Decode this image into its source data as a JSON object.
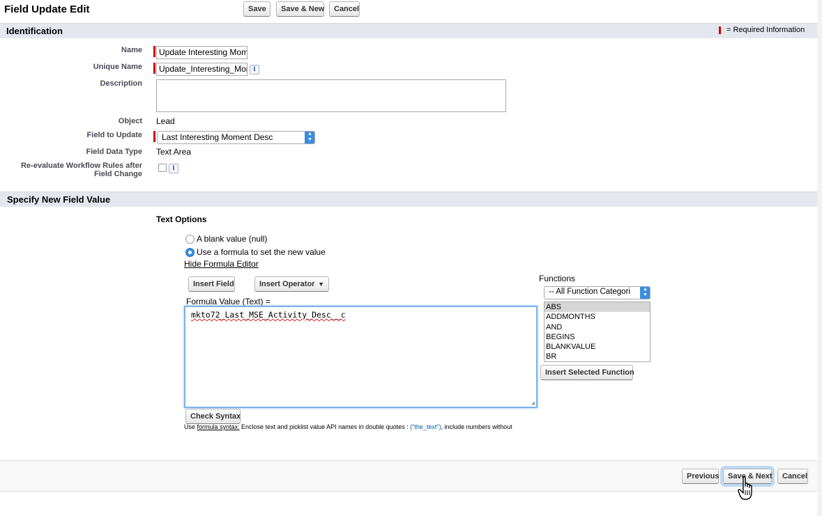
{
  "header": {
    "title": "Field Update Edit",
    "save_label": "Save",
    "save_new_label": "Save & New",
    "cancel_label": "Cancel"
  },
  "identification": {
    "section_title": "Identification",
    "required_legend": "= Required Information",
    "name_label": "Name",
    "name_value": "Update Interesting Mom",
    "unique_name_label": "Unique Name",
    "unique_name_value": "Update_Interesting_Mor",
    "info_icon_text": "i",
    "description_label": "Description",
    "description_value": "",
    "object_label": "Object",
    "object_value": "Lead",
    "field_to_update_label": "Field to Update",
    "field_to_update_value": "Last Interesting Moment Desc",
    "field_data_type_label": "Field Data Type",
    "field_data_type_value": "Text Area",
    "reevaluate_label_line1": "Re-evaluate Workflow Rules after",
    "reevaluate_label_line2": "Field Change",
    "reevaluate_checked": false
  },
  "field_value": {
    "section_title": "Specify New Field Value",
    "text_options_label": "Text Options",
    "option_blank": "A blank value (null)",
    "option_formula": "Use a formula to set the new value",
    "selected_option": "formula",
    "hide_editor_link": "Hide Formula Editor",
    "insert_field_label": "Insert Field",
    "insert_operator_label": "Insert Operator",
    "formula_value_label": "Formula Value (Text) =",
    "formula_text": "mkto72_Last_MSE_Activity_Desc__c",
    "check_syntax_label": "Check Syntax",
    "help_prefix": "Use ",
    "help_link": "formula syntax:",
    "help_text": " Enclose text and picklist value API names in double quotes : ",
    "help_example": "(\"the_text\")",
    "help_suffix": ", include numbers without",
    "functions_label": "Functions",
    "function_category": "-- All Function Categori",
    "functions": [
      "ABS",
      "ADDMONTHS",
      "AND",
      "BEGINS",
      "BLANKVALUE",
      "BR"
    ],
    "selected_function": "ABS",
    "insert_function_label": "Insert Selected Function"
  },
  "footer": {
    "previous_label": "Previous",
    "save_next_label": "Save & Next",
    "cancel_label": "Cancel"
  },
  "colors": {
    "section_bg": "#e4e7ee",
    "required_marker": "#cc0000",
    "select_accent": "#3b8de0",
    "link": "#015ba7"
  }
}
